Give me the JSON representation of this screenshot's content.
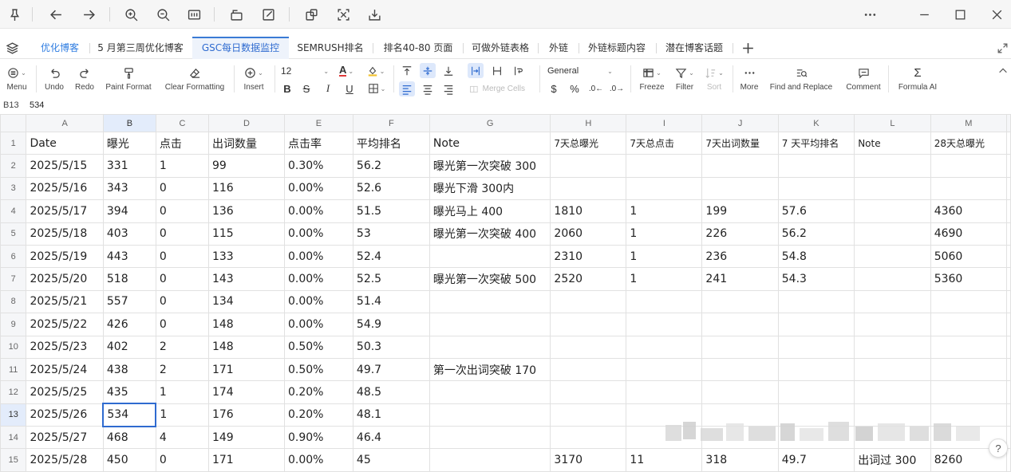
{
  "tabs": [
    {
      "label": "优化博客",
      "style": "link"
    },
    {
      "label": "5 月第三周优化博客",
      "style": "normal"
    },
    {
      "label": "GSC每日数据监控",
      "style": "active"
    },
    {
      "label": "SEMRUSH排名",
      "style": "normal"
    },
    {
      "label": "排名40-80 页面",
      "style": "normal"
    },
    {
      "label": "可做外链表格",
      "style": "normal"
    },
    {
      "label": "外链",
      "style": "normal"
    },
    {
      "label": "外链标题内容",
      "style": "normal"
    },
    {
      "label": "潜在博客话题",
      "style": "normal"
    }
  ],
  "ribbon": {
    "menu": "Menu",
    "undo": "Undo",
    "redo": "Redo",
    "paint_format": "Paint Format",
    "clear_formatting": "Clear Formatting",
    "insert": "Insert",
    "font_size": "12",
    "merge_cells": "Merge Cells",
    "number_format": "General",
    "currency": "$",
    "percent": "%",
    "freeze": "Freeze",
    "filter": "Filter",
    "sort": "Sort",
    "more": "More",
    "find_replace": "Find and Replace",
    "comment": "Comment",
    "formula_ai": "Formula AI"
  },
  "formula_bar": {
    "cell_ref": "B13",
    "value": "534"
  },
  "columns": [
    "A",
    "B",
    "C",
    "D",
    "E",
    "F",
    "G",
    "H",
    "I",
    "J",
    "K",
    "L",
    "M"
  ],
  "selected_column": "B",
  "selected_row": "13",
  "rows": [
    {
      "n": "1",
      "cells": [
        "Date",
        "曝光",
        "点击",
        "出词数量",
        "点击率",
        "平均排名",
        "Note",
        "7天总曝光",
        "7天总点击",
        "7天出词数量",
        "7 天平均排名",
        "Note",
        "28天总曝光"
      ]
    },
    {
      "n": "2",
      "cells": [
        "2025/5/15",
        "331",
        "1",
        "99",
        "0.30%",
        "56.2",
        " 曝光第一次突破 300",
        "",
        "",
        "",
        "",
        "",
        ""
      ]
    },
    {
      "n": "3",
      "cells": [
        "2025/5/16",
        "343",
        "0",
        "116",
        "0.00%",
        "52.6",
        "曝光下滑 300内",
        "",
        "",
        "",
        "",
        "",
        ""
      ]
    },
    {
      "n": "4",
      "cells": [
        "2025/5/17",
        "394",
        "0",
        "136",
        "0.00%",
        "51.5",
        "曝光马上 400",
        "1810",
        "1",
        "199",
        "57.6",
        "",
        "4360"
      ]
    },
    {
      "n": "5",
      "cells": [
        "2025/5/18",
        "403",
        "0",
        "115",
        "0.00%",
        "53",
        "曝光第一次突破 400",
        "2060",
        "1",
        "226",
        "56.2",
        "",
        "4690"
      ]
    },
    {
      "n": "6",
      "cells": [
        "2025/5/19",
        "443",
        "0",
        "133",
        "0.00%",
        "52.4",
        "",
        "2310",
        "1",
        "236",
        "54.8",
        "",
        "5060"
      ]
    },
    {
      "n": "7",
      "cells": [
        "2025/5/20",
        "518",
        "0",
        "143",
        "0.00%",
        "52.5",
        "曝光第一次突破 500",
        "2520",
        "1",
        "241",
        "54.3",
        "",
        "5360"
      ]
    },
    {
      "n": "8",
      "cells": [
        "2025/5/21",
        "557",
        "0",
        "134",
        "0.00%",
        "51.4",
        "",
        "",
        "",
        "",
        "",
        "",
        ""
      ]
    },
    {
      "n": "9",
      "cells": [
        "2025/5/22",
        "426",
        "0",
        "148",
        "0.00%",
        "54.9",
        "",
        "",
        "",
        "",
        "",
        "",
        ""
      ]
    },
    {
      "n": "10",
      "cells": [
        "2025/5/23",
        "402",
        "2",
        "148",
        "0.50%",
        "50.3",
        "",
        "",
        "",
        "",
        "",
        "",
        ""
      ]
    },
    {
      "n": "11",
      "cells": [
        "2025/5/24",
        "438",
        "2",
        "171",
        "0.50%",
        "49.7",
        "第一次出词突破 170",
        "",
        "",
        "",
        "",
        "",
        ""
      ]
    },
    {
      "n": "12",
      "cells": [
        "2025/5/25",
        "435",
        "1",
        "174",
        "0.20%",
        "48.5",
        "",
        "",
        "",
        "",
        "",
        "",
        ""
      ]
    },
    {
      "n": "13",
      "cells": [
        "2025/5/26",
        "534",
        "1",
        "176",
        "0.20%",
        "48.1",
        "",
        "",
        "",
        "",
        "",
        "",
        ""
      ]
    },
    {
      "n": "14",
      "cells": [
        "2025/5/27",
        "468",
        "4",
        "149",
        "0.90%",
        "46.4",
        "",
        "",
        "",
        "",
        "",
        "",
        ""
      ]
    },
    {
      "n": "15",
      "cells": [
        "2025/5/28",
        "450",
        "0",
        "171",
        "0.00%",
        "45",
        "",
        "3170",
        "11",
        "318",
        "49.7",
        "出词过 300",
        "8260"
      ]
    }
  ],
  "help_label": "?"
}
